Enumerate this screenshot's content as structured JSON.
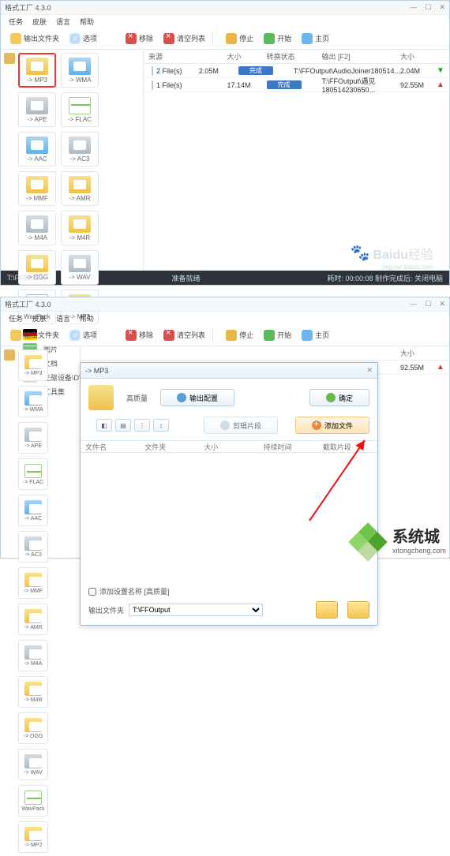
{
  "app_title": "格式工厂 4.3.0",
  "menu": {
    "task": "任务",
    "skin": "皮肤",
    "lang": "语言",
    "help": "帮助"
  },
  "toolbar": {
    "out_folder": "输出文件夹",
    "option": "选项",
    "remove": "移除",
    "clear": "清空列表",
    "stop": "停止",
    "start": "开始",
    "home": "主页"
  },
  "formats": [
    {
      "label": "-> MP3",
      "style": "",
      "selected": true
    },
    {
      "label": "-> WMA",
      "style": "blue"
    },
    {
      "label": "-> APE",
      "style": "gray"
    },
    {
      "label": "-> FLAC",
      "style": "green",
      "wave": true
    },
    {
      "label": "-> AAC",
      "style": "blue"
    },
    {
      "label": "-> AC3",
      "style": "gray"
    },
    {
      "label": "-> MMF",
      "style": ""
    },
    {
      "label": "-> AMR",
      "style": ""
    },
    {
      "label": "-> M4A",
      "style": "gray"
    },
    {
      "label": "-> M4R",
      "style": ""
    },
    {
      "label": "-> OGG",
      "style": ""
    },
    {
      "label": "-> WAV",
      "style": "gray"
    },
    {
      "label": "WavPack",
      "style": "green",
      "wave": true
    },
    {
      "label": "-> MP2",
      "style": ""
    }
  ],
  "left_categories": {
    "picture": "图片",
    "document": "文档",
    "dvd": "光驱设备\\DVD\\CD\\ISO",
    "tools": "工具集"
  },
  "list": {
    "headers": {
      "name": "来源",
      "size": "大小",
      "status": "转换状态",
      "output": "输出 [F2]",
      "outsize": "大小"
    },
    "rows": [
      {
        "name": "2 File(s)",
        "size": "2.05M",
        "status": "完成",
        "output": "T:\\FFOutput\\AudioJoiner180514...",
        "outsize": "2.04M",
        "dir": "down"
      },
      {
        "name": "1 File(s)",
        "size": "17.14M",
        "status": "完成",
        "output": "T:\\FFOutput\\遇见180514230650...",
        "outsize": "92.55M",
        "dir": "up"
      }
    ]
  },
  "status": {
    "left": "T:\\FFOutput",
    "mid": "准备就绪",
    "right": "耗时: 00:00:08   制作完成后: 关闭电脑"
  },
  "watermark": {
    "brand": "Baidu",
    "text": "经验",
    "sub": "jingyan.baidu.com"
  },
  "dialog": {
    "title": "-> MP3",
    "high_q": "高质量",
    "out_conf": "输出配置",
    "confirm": "确定",
    "del_slice": "剪辑片段",
    "add_file": "添加文件",
    "cols": {
      "file": "文件名",
      "folder": "文件夹",
      "size": "大小",
      "dur": "持续时间",
      "slice": "截取片段"
    },
    "chk_label": "添加设置名称 [高质量]",
    "out_label": "输出文件夹",
    "out_value": "T:\\FFOutput"
  },
  "table_row2": {
    "size": "大小",
    "outsize": "92.55M"
  },
  "logo": {
    "main": "系统城",
    "sub": "xitongcheng.com"
  }
}
